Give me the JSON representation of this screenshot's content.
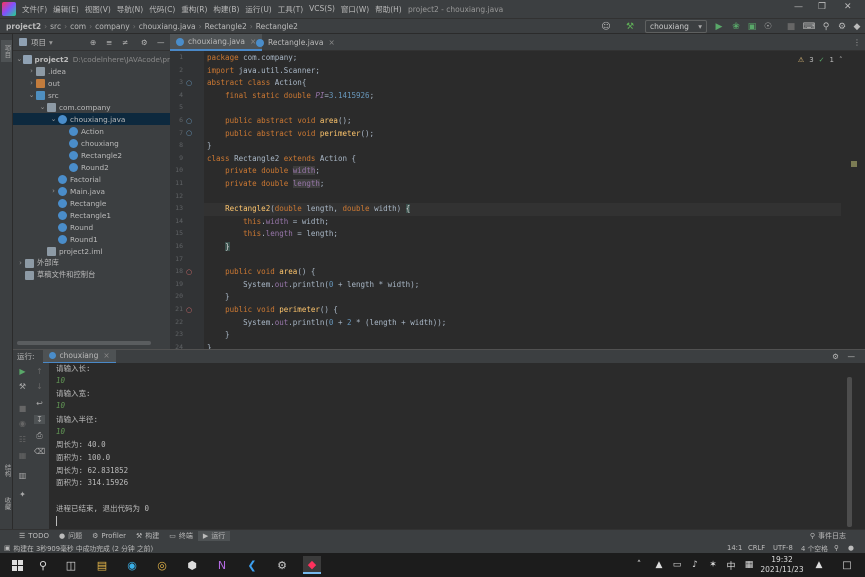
{
  "menu": [
    "文件(F)",
    "编辑(E)",
    "视图(V)",
    "导航(N)",
    "代码(C)",
    "重构(R)",
    "构建(B)",
    "运行(U)",
    "工具(T)",
    "VCS(S)",
    "窗口(W)",
    "帮助(H)"
  ],
  "window_title": "project2 - chouxiang.java",
  "breadcrumbs": [
    "project2",
    "src",
    "com",
    "company",
    "chouxiang.java",
    "Rectangle2",
    "Rectangle2"
  ],
  "run_config": "chouxiang",
  "project_panel": {
    "title": "项目"
  },
  "tree": [
    {
      "label": "project2",
      "path": "D:\\codelnhere\\JAVAcode\\pr",
      "indent": 0,
      "icon": "foldp",
      "open": true
    },
    {
      "label": ".idea",
      "indent": 1,
      "icon": "fold",
      "open": false
    },
    {
      "label": "out",
      "indent": 1,
      "icon": "foldo",
      "open": false
    },
    {
      "label": "src",
      "indent": 1,
      "icon": "foldb",
      "open": true
    },
    {
      "label": "com.company",
      "indent": 2,
      "icon": "fold",
      "open": true
    },
    {
      "label": "chouxiang.java",
      "indent": 3,
      "icon": "cls",
      "open": true,
      "selected": true
    },
    {
      "label": "Action",
      "indent": 4,
      "icon": "cls"
    },
    {
      "label": "chouxiang",
      "indent": 4,
      "icon": "cls"
    },
    {
      "label": "Rectangle2",
      "indent": 4,
      "icon": "cls"
    },
    {
      "label": "Round2",
      "indent": 4,
      "icon": "cls"
    },
    {
      "label": "Factorial",
      "indent": 3,
      "icon": "cls"
    },
    {
      "label": "Main.java",
      "indent": 3,
      "icon": "cls",
      "open": false
    },
    {
      "label": "Rectangle",
      "indent": 3,
      "icon": "cls"
    },
    {
      "label": "Rectangle1",
      "indent": 3,
      "icon": "cls"
    },
    {
      "label": "Round",
      "indent": 3,
      "icon": "cls"
    },
    {
      "label": "Round1",
      "indent": 3,
      "icon": "cls"
    },
    {
      "label": "project2.iml",
      "indent": 2,
      "icon": "fold"
    },
    {
      "label": "外部库",
      "indent": 0,
      "icon": "fold",
      "open": false
    },
    {
      "label": "草稿文件和控制台",
      "indent": 0,
      "icon": "fold"
    }
  ],
  "editor_tabs": [
    "chouxiang.java",
    "Rectangle.java"
  ],
  "inspections": {
    "warnings": "3",
    "ok": "1"
  },
  "code_lines": [
    "package com.company;",
    "import java.util.Scanner;",
    "abstract class Action{",
    "    final static double PI=3.1415926;",
    "",
    "    public abstract void area();",
    "    public abstract void perimeter();",
    "}",
    "class Rectangle2 extends Action {",
    "    private double width;",
    "    private double length;",
    "",
    "    Rectangle2(double length, double width) {",
    "        this.width = width;",
    "        this.length = length;",
    "    }",
    "",
    "    public void area() {",
    "        System.out.println(\"面积为: \" + length * width);",
    "    }",
    "    public void perimeter() {",
    "        System.out.println(\"周长为: \" + 2 * (length + width));",
    "    }",
    "}"
  ],
  "line_numbers": [
    "1",
    "2",
    "3",
    "4",
    "5",
    "6",
    "7",
    "8",
    "9",
    "10",
    "11",
    "12",
    "13",
    "14",
    "15",
    "16",
    "17",
    "18",
    "19",
    "20",
    "21",
    "22",
    "23",
    "24"
  ],
  "run_panel": {
    "label": "运行:",
    "tab": "chouxiang"
  },
  "console": [
    {
      "text": "请输入长:",
      "input": false
    },
    {
      "text": "10",
      "input": true
    },
    {
      "text": "请输入宽:",
      "input": false
    },
    {
      "text": "10",
      "input": true
    },
    {
      "text": "请输入半径:",
      "input": false
    },
    {
      "text": "10",
      "input": true
    },
    {
      "text": "周长为: 40.0",
      "input": false
    },
    {
      "text": "面积为: 100.0",
      "input": false
    },
    {
      "text": "周长为: 62.831852",
      "input": false
    },
    {
      "text": "面积为: 314.15926",
      "input": false
    },
    {
      "text": "",
      "input": false
    },
    {
      "text": "进程已结束, 退出代码为 0",
      "input": false
    }
  ],
  "bottom_tabs": [
    "TODO",
    "问题",
    "Profiler",
    "构建",
    "终端",
    "运行"
  ],
  "event_log": "事件日志",
  "status": {
    "message": "构建在 3秒909毫秒 中成功完成 (2 分钟 之前)",
    "position": "14:1",
    "line_sep": "CRLF",
    "encoding": "UTF-8",
    "indent": "4 个空格"
  },
  "side_labels": {
    "project": "项目",
    "structure": "结构",
    "favorites": "收藏"
  },
  "taskbar": {
    "time": "19:32",
    "date": "2021/11/23",
    "ime": "中"
  }
}
